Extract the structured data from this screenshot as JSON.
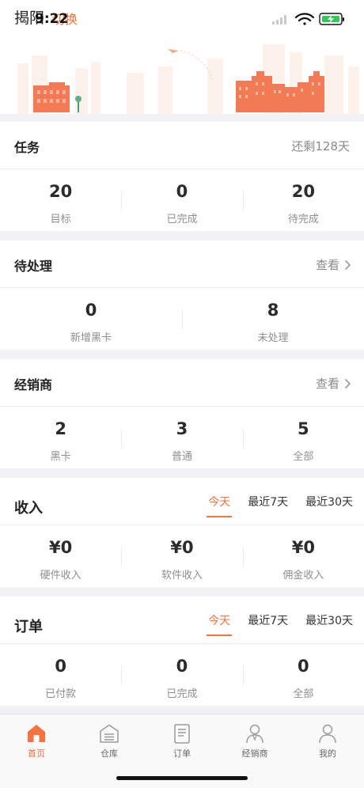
{
  "header": {
    "city": "揭阳",
    "switch_label": "切换",
    "time": "9:22"
  },
  "task": {
    "title": "任务",
    "remaining": "还剩128天",
    "stats": [
      {
        "value": "20",
        "label": "目标"
      },
      {
        "value": "0",
        "label": "已完成"
      },
      {
        "value": "20",
        "label": "待完成"
      }
    ]
  },
  "pending": {
    "title": "待处理",
    "view_label": "查看",
    "stats": [
      {
        "value": "0",
        "label": "新增黑卡"
      },
      {
        "value": "8",
        "label": "未处理"
      }
    ]
  },
  "dealer": {
    "title": "经销商",
    "view_label": "查看",
    "stats": [
      {
        "value": "2",
        "label": "黑卡"
      },
      {
        "value": "3",
        "label": "普通"
      },
      {
        "value": "5",
        "label": "全部"
      }
    ]
  },
  "income": {
    "title": "收入",
    "tabs": [
      "今天",
      "最近7天",
      "最近30天"
    ],
    "active_tab": "今天",
    "stats": [
      {
        "value": "¥0",
        "label": "硬件收入"
      },
      {
        "value": "¥0",
        "label": "软件收入"
      },
      {
        "value": "¥0",
        "label": "佣金收入"
      }
    ]
  },
  "orders": {
    "title": "订单",
    "tabs": [
      "今天",
      "最近7天",
      "最近30天"
    ],
    "active_tab": "今天",
    "stats": [
      {
        "value": "0",
        "label": "已付款"
      },
      {
        "value": "0",
        "label": "已完成"
      },
      {
        "value": "0",
        "label": "全部"
      }
    ]
  },
  "tabbar": {
    "items": [
      {
        "label": "首页",
        "icon": "home-icon",
        "active": true
      },
      {
        "label": "仓库",
        "icon": "warehouse-icon",
        "active": false
      },
      {
        "label": "订单",
        "icon": "document-icon",
        "active": false
      },
      {
        "label": "经销商",
        "icon": "dealer-icon",
        "active": false
      },
      {
        "label": "我的",
        "icon": "profile-icon",
        "active": false
      }
    ]
  },
  "colors": {
    "accent": "#f4733e",
    "background": "#f2f2f4",
    "text": "#333333",
    "muted": "#8e8e8e"
  }
}
